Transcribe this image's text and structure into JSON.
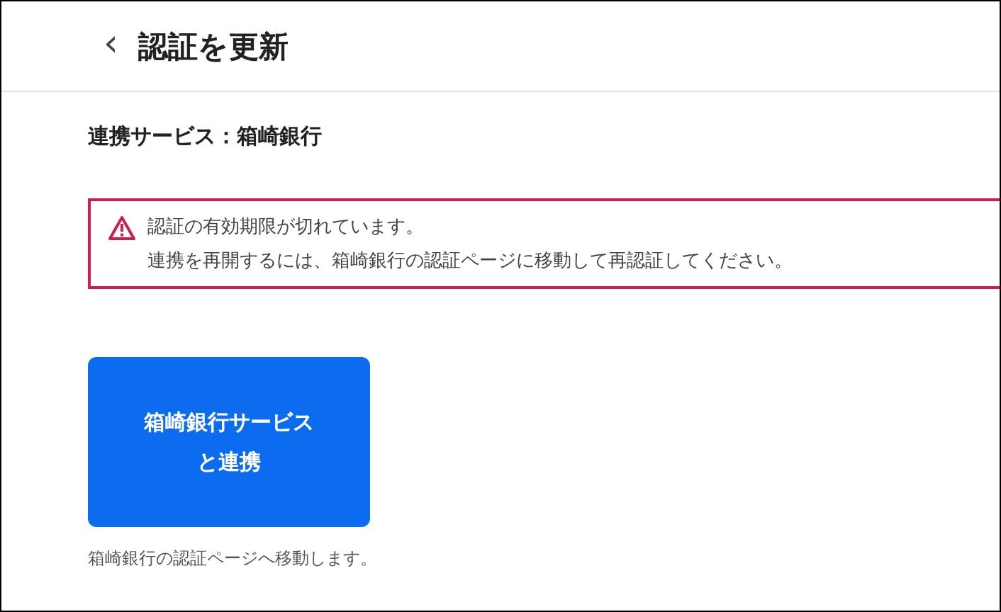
{
  "header": {
    "back_icon": "‹",
    "title": "認証を更新"
  },
  "service_label": "連携サービス：箱崎銀行",
  "alert": {
    "lines": [
      "認証の有効期限が切れています。",
      "連携を再開するには、箱崎銀行の認証ページに移動して再認証してください。"
    ]
  },
  "connect_button": {
    "label_lines": [
      "箱崎銀行サービス",
      "と連携"
    ]
  },
  "caption": "箱崎銀行の認証ページへ移動します。"
}
